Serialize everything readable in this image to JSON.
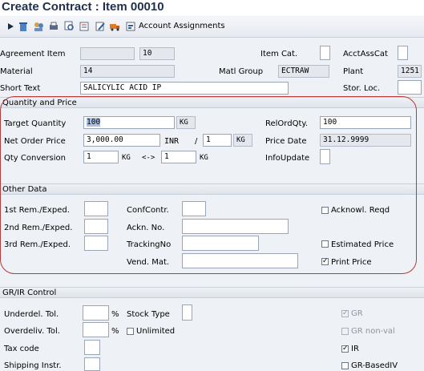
{
  "title": "Create Contract : Item 00010",
  "toolbar": {
    "account_assignments": "Account Assignments"
  },
  "header": {
    "agreement_item_label": "Agreement Item",
    "agreement_item_value": "10",
    "item_cat_label": "Item Cat.",
    "acct_ass_cat_label": "AcctAssCat",
    "material_label": "Material",
    "material_value": "14",
    "matl_group_label": "Matl Group",
    "matl_group_value": "ECTRAW",
    "plant_label": "Plant",
    "plant_value": "1251",
    "short_text_label": "Short Text",
    "short_text_value": "SALICYLIC ACID IP",
    "stor_loc_label": "Stor. Loc."
  },
  "qty": {
    "section_title": "Quantity and Price",
    "target_qty_label": "Target Quantity",
    "target_qty_value": "100",
    "target_qty_unit": "KG",
    "rel_ord_qty_label": "RelOrdQty.",
    "rel_ord_qty_value": "100",
    "net_price_label": "Net Order Price",
    "net_price_value": "3,000.00",
    "currency": "INR",
    "slash": "/",
    "price_unit_value": "1",
    "price_unit": "KG",
    "price_date_label": "Price Date",
    "price_date_value": "31.12.9999",
    "qty_conv_label": "Qty Conversion",
    "conv_left_value": "1",
    "conv_left_unit": "KG",
    "conv_arrow": "<->",
    "conv_right_value": "1",
    "conv_right_unit": "KG",
    "info_update_label": "InfoUpdate"
  },
  "other": {
    "section_title": "Other Data",
    "rem1_label": "1st Rem./Exped.",
    "rem2_label": "2nd Rem./Exped.",
    "rem3_label": "3rd Rem./Exped.",
    "conf_contr_label": "ConfContr.",
    "ackn_no_label": "Ackn. No.",
    "tracking_no_label": "TrackingNo",
    "vend_mat_label": "Vend. Mat.",
    "acknowl_reqd_label": "Acknowl. Reqd",
    "acknowl_reqd_checked": false,
    "estimated_price_label": "Estimated Price",
    "estimated_price_checked": false,
    "print_price_label": "Print Price",
    "print_price_checked": true
  },
  "grir": {
    "section_title": "GR/IR Control",
    "underdel_label": "Underdel. Tol.",
    "overdeliv_label": "Overdeliv. Tol.",
    "percent": "%",
    "stock_type_label": "Stock Type",
    "unlimited_label": "Unlimited",
    "tax_code_label": "Tax code",
    "shipping_label": "Shipping Instr.",
    "gr_label": "GR",
    "gr_non_val_label": "GR non-val",
    "ir_label": "IR",
    "gr_based_iv_label": "GR-BasedIV",
    "checkmark": "✓"
  },
  "colors": {
    "highlight_oval": "#b83a3a",
    "title_text": "#1f2f4d"
  }
}
